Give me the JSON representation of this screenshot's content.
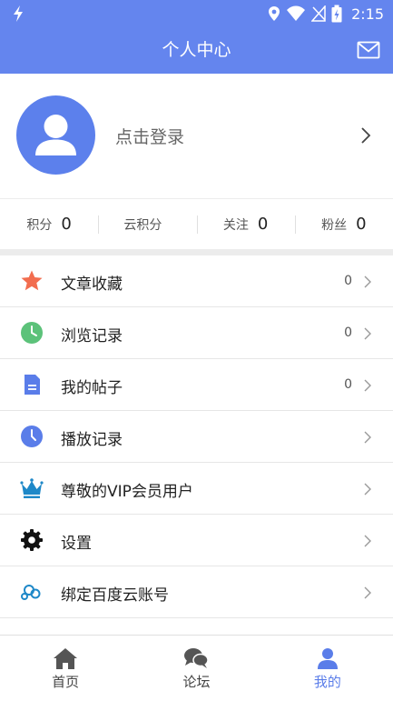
{
  "status_bar": {
    "time": "2:15"
  },
  "app_bar": {
    "title": "个人中心"
  },
  "profile": {
    "login_text": "点击登录"
  },
  "stats": [
    {
      "label": "积分",
      "value": "0"
    },
    {
      "label": "云积分",
      "value": ""
    },
    {
      "label": "关注",
      "value": "0"
    },
    {
      "label": "粉丝",
      "value": "0"
    }
  ],
  "menu": [
    {
      "label": "文章收藏",
      "count": "0",
      "icon": "star-icon",
      "color": "#f26d4f"
    },
    {
      "label": "浏览记录",
      "count": "0",
      "icon": "clock-icon",
      "color": "#5cc27a"
    },
    {
      "label": "我的帖子",
      "count": "0",
      "icon": "document-icon",
      "color": "#5a7de9"
    },
    {
      "label": "播放记录",
      "count": "",
      "icon": "history-icon",
      "color": "#5a7de9"
    },
    {
      "label": "尊敬的VIP会员用户",
      "count": "",
      "icon": "crown-icon",
      "color": "#1e88c8"
    },
    {
      "label": "设置",
      "count": "",
      "icon": "gear-icon",
      "color": "#111111"
    },
    {
      "label": "绑定百度云账号",
      "count": "",
      "icon": "cloud-icon",
      "color": "#1e88c8"
    }
  ],
  "bottom_nav": [
    {
      "label": "首页",
      "icon": "home-icon"
    },
    {
      "label": "论坛",
      "icon": "chat-icon"
    },
    {
      "label": "我的",
      "icon": "user-icon",
      "active": true
    }
  ],
  "colors": {
    "primary": "#6485ee",
    "avatar": "#5c80ec",
    "active_tab": "#5a7de9"
  }
}
